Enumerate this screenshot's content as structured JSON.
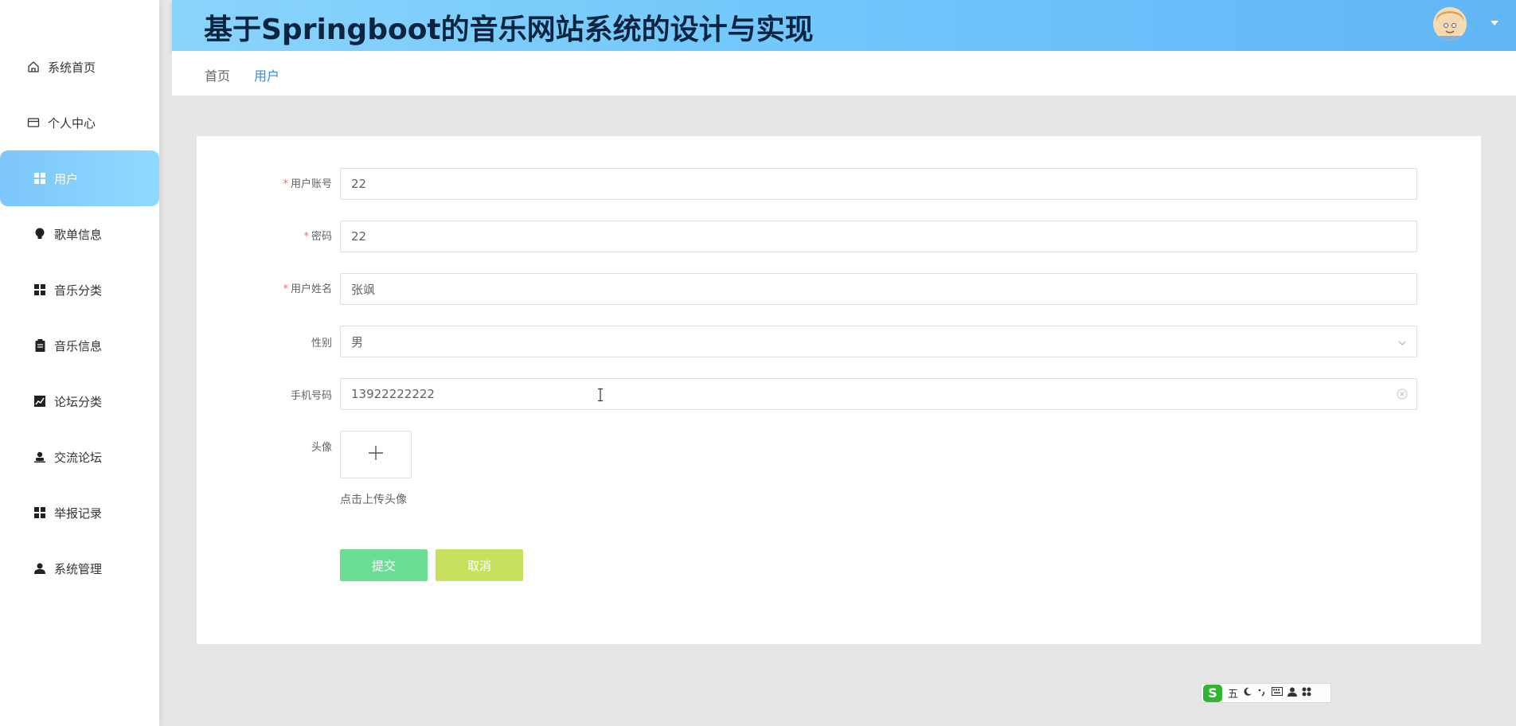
{
  "app": {
    "title": "基于Springboot的音乐网站系统的设计与实现"
  },
  "sidebar": {
    "items": [
      {
        "label": "系统首页",
        "icon": "home-icon"
      },
      {
        "label": "个人中心",
        "icon": "card-icon"
      },
      {
        "label": "用户",
        "icon": "grid-icon",
        "active": true
      },
      {
        "label": "歌单信息",
        "icon": "bulb-icon"
      },
      {
        "label": "音乐分类",
        "icon": "grid-icon"
      },
      {
        "label": "音乐信息",
        "icon": "clipboard-icon"
      },
      {
        "label": "论坛分类",
        "icon": "chart-icon"
      },
      {
        "label": "交流论坛",
        "icon": "user-stand-icon"
      },
      {
        "label": "举报记录",
        "icon": "grid-icon"
      },
      {
        "label": "系统管理",
        "icon": "person-icon"
      }
    ]
  },
  "breadcrumb": {
    "items": [
      "首页",
      "用户"
    ]
  },
  "form": {
    "account": {
      "label": "用户账号",
      "value": "22",
      "required": true
    },
    "password": {
      "label": "密码",
      "value": "22",
      "required": true
    },
    "name": {
      "label": "用户姓名",
      "value": "张飒",
      "required": true
    },
    "gender": {
      "label": "性别",
      "value": "男"
    },
    "phone": {
      "label": "手机号码",
      "value": "13922222222"
    },
    "avatar": {
      "label": "头像",
      "hint": "点击上传头像"
    },
    "submit_label": "提交",
    "cancel_label": "取消",
    "required_mark": "*"
  },
  "ime": {
    "logo": "S",
    "mode": "五"
  },
  "colors": {
    "header_start": "#8ad4fb",
    "header_end": "#61b6f6",
    "active_menu": "#7cc6fb",
    "submit": "#6bde94",
    "cancel": "#c7e05e",
    "required": "#f56c6c"
  }
}
